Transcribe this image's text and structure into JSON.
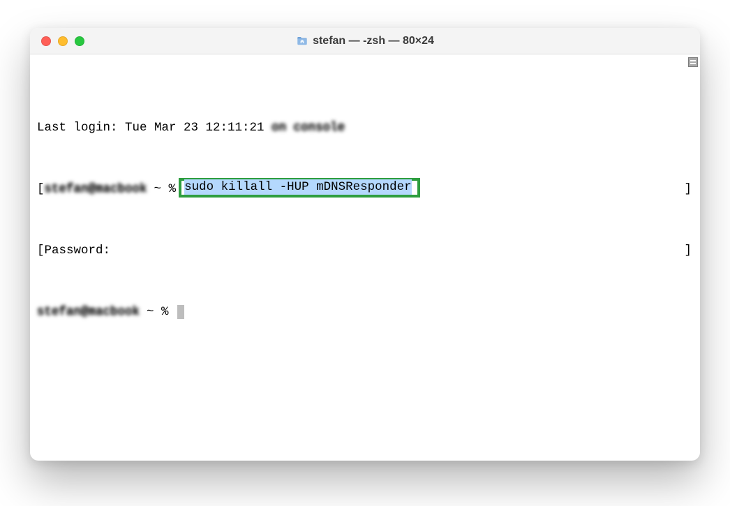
{
  "window": {
    "title": "stefan — -zsh — 80×24"
  },
  "terminal": {
    "last_login_prefix": "Last login: Tue Mar 23 12:11:21 ",
    "last_login_suffix_blur": "on console",
    "host_blur": "stefan@macbook",
    "prompt_symbol": "~ %",
    "command": "sudo killall -HUP mDNSResponder",
    "password_label": "Password:"
  },
  "colors": {
    "highlight_border": "#2e9e3f",
    "selection_bg": "#b4d8fd"
  }
}
